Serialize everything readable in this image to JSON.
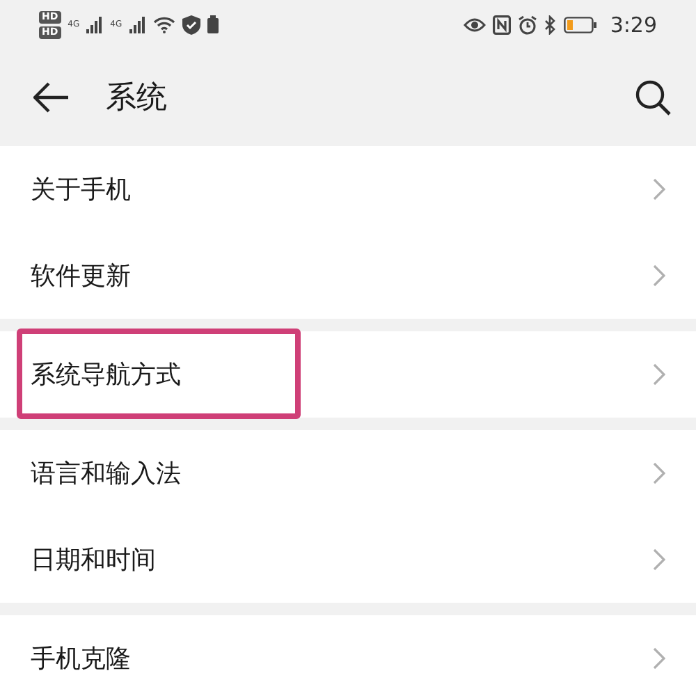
{
  "status_bar": {
    "hd_labels": [
      "HD",
      "HD"
    ],
    "network_labels": [
      "4G",
      "4G"
    ],
    "time": "3:29"
  },
  "header": {
    "title": "系统"
  },
  "groups": [
    {
      "items": [
        {
          "label": "关于手机",
          "highlighted": false
        },
        {
          "label": "软件更新",
          "highlighted": false
        }
      ]
    },
    {
      "items": [
        {
          "label": "系统导航方式",
          "highlighted": true
        }
      ]
    },
    {
      "items": [
        {
          "label": "语言和输入法",
          "highlighted": false
        },
        {
          "label": "日期和时间",
          "highlighted": false
        }
      ]
    },
    {
      "items": [
        {
          "label": "手机克隆",
          "highlighted": false
        }
      ]
    }
  ]
}
